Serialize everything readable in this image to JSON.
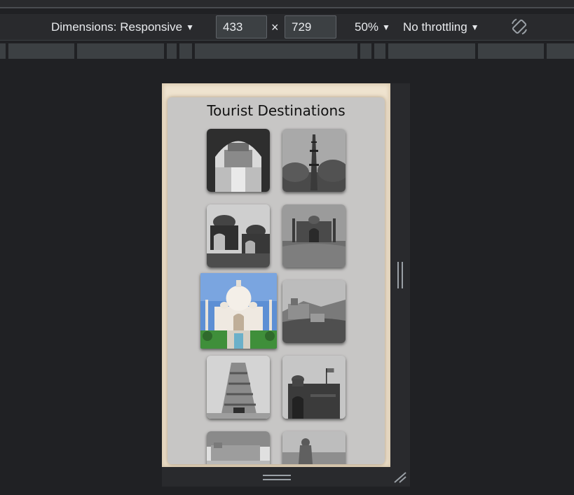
{
  "toolbar": {
    "dimensions_label": "Dimensions: Responsive",
    "width_value": "433",
    "times_sign": "×",
    "height_value": "729",
    "zoom_label": "50%",
    "throttling_label": "No throttling",
    "rotate_icon": "rotate-device-icon"
  },
  "page": {
    "title": "Tourist Destinations",
    "thumbnails": [
      {
        "icon": "palace-arch-photo",
        "tone": "grayscale"
      },
      {
        "icon": "minaret-tower-photo",
        "tone": "grayscale"
      },
      {
        "icon": "cenotaphs-photo",
        "tone": "grayscale"
      },
      {
        "icon": "mosque-photo",
        "tone": "grayscale"
      },
      {
        "icon": "taj-mahal-photo",
        "tone": "color",
        "state": "hovered"
      },
      {
        "icon": "hill-fort-photo",
        "tone": "grayscale"
      },
      {
        "icon": "temple-gopuram-photo",
        "tone": "grayscale"
      },
      {
        "icon": "red-fort-photo",
        "tone": "grayscale"
      },
      {
        "icon": "desert-fort-photo",
        "tone": "grayscale"
      },
      {
        "icon": "statue-photo",
        "tone": "grayscale"
      }
    ]
  },
  "colors": {
    "devtools_bg": "#202124",
    "toolbar_bg": "#292a2d",
    "frame_bg": "#efe3cf",
    "panel_bg": "#c7c6c5"
  }
}
